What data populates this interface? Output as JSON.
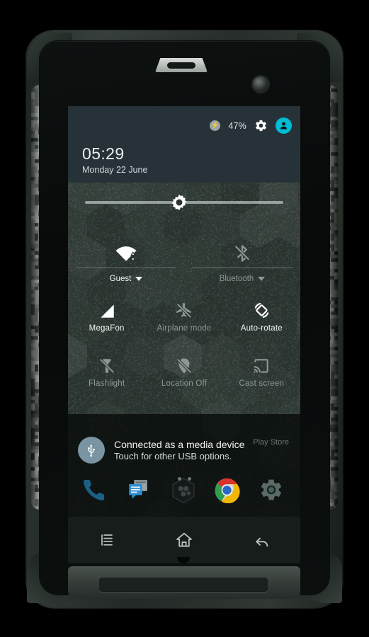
{
  "device": {
    "type": "rugged-android-smartphone",
    "screen_label": "quick-settings-panel"
  },
  "statusbar": {
    "battery_icon": "battery-charging-icon",
    "battery_percent": "47%",
    "settings_icon": "gear-icon",
    "user_icon": "user-avatar-icon",
    "accent_color": "#00bcd4"
  },
  "header": {
    "time": "05:29",
    "date": "Monday 22 June",
    "background_color": "#263238"
  },
  "brightness": {
    "name": "brightness-slider",
    "icon": "brightness-sun-icon",
    "value_percent": 47
  },
  "dual_tiles": [
    {
      "id": "wifi",
      "icon": "wifi-icon",
      "label": "Guest",
      "state": "on",
      "has_caret": true
    },
    {
      "id": "bluetooth",
      "icon": "bluetooth-off-icon",
      "label": "Bluetooth",
      "state": "off",
      "has_caret": true
    }
  ],
  "tile_rows": [
    [
      {
        "id": "cellular",
        "icon": "signal-bars-icon",
        "label": "MegaFon",
        "state": "on"
      },
      {
        "id": "airplane",
        "icon": "airplane-off-icon",
        "label": "Airplane mode",
        "state": "off"
      },
      {
        "id": "autorotate",
        "icon": "auto-rotate-icon",
        "label": "Auto-rotate",
        "state": "on"
      }
    ],
    [
      {
        "id": "flashlight",
        "icon": "flashlight-off-icon",
        "label": "Flashlight",
        "state": "off"
      },
      {
        "id": "location",
        "icon": "location-off-icon",
        "label": "Location Off",
        "state": "off"
      },
      {
        "id": "castscreen",
        "icon": "cast-screen-icon",
        "label": "Cast screen",
        "state": "off"
      }
    ]
  ],
  "notification": {
    "icon": "usb-icon",
    "title": "Connected as a media device",
    "subtitle": "Touch for other USB options.",
    "icon_color": "#7a94a3"
  },
  "homescreen": {
    "ghost_label": "Play Store",
    "page_dots": 2,
    "dock": [
      {
        "id": "phone",
        "icon": "phone-icon"
      },
      {
        "id": "messaging",
        "icon": "messages-icon"
      },
      {
        "id": "app-drawer",
        "icon": "app-drawer-hexagon-icon"
      },
      {
        "id": "chrome",
        "icon": "chrome-browser-icon"
      },
      {
        "id": "settings",
        "icon": "settings-gear-icon"
      }
    ]
  },
  "navbar": [
    {
      "id": "recents",
      "icon": "recents-menu-icon"
    },
    {
      "id": "home",
      "icon": "home-house-icon"
    },
    {
      "id": "back",
      "icon": "back-arrow-icon"
    }
  ]
}
